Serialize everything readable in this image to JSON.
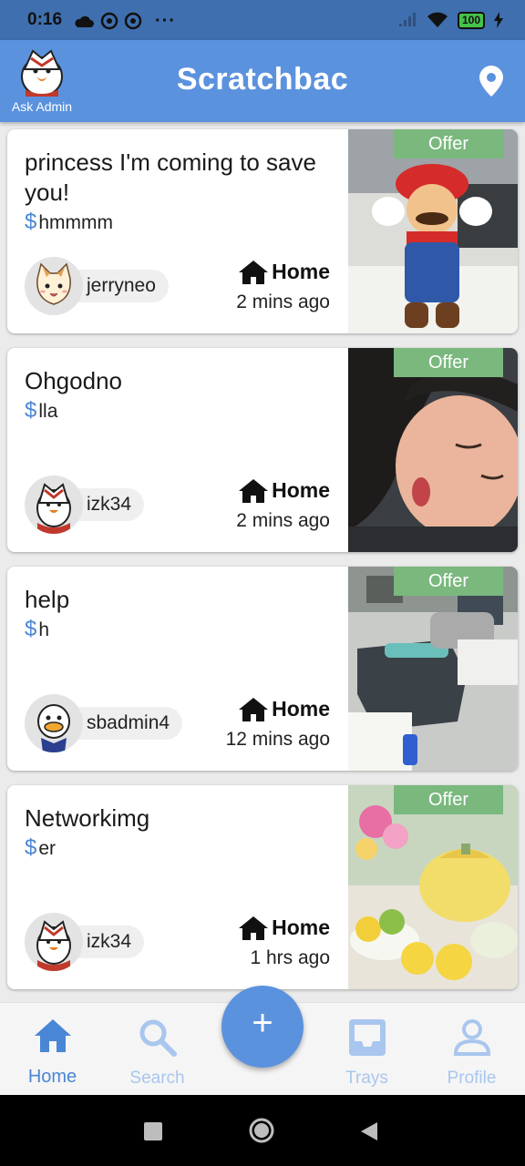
{
  "status_bar": {
    "time": "0:16",
    "battery": "100"
  },
  "header": {
    "title": "Scratchbac",
    "admin_label": "Ask Admin"
  },
  "listings": [
    {
      "title": "princess I'm coming to save you!",
      "price": "hmmmm",
      "user": "jerryneo",
      "location": "Home",
      "time_ago": "2 mins ago",
      "badge": "Offer"
    },
    {
      "title": "Ohgodno",
      "price": "lla",
      "user": "izk34",
      "location": "Home",
      "time_ago": "2 mins ago",
      "badge": "Offer"
    },
    {
      "title": "help",
      "price": "h",
      "user": "sbadmin4",
      "location": "Home",
      "time_ago": "12 mins ago",
      "badge": "Offer"
    },
    {
      "title": "Networkimg",
      "price": "er",
      "user": "izk34",
      "location": "Home",
      "time_ago": "1 hrs ago",
      "badge": "Offer"
    }
  ],
  "bottom_nav": {
    "home": "Home",
    "search": "Search",
    "add": "+",
    "trays": "Trays",
    "profile": "Profile"
  },
  "colors": {
    "brand": "#5b92de",
    "nav_active": "#4a86d6",
    "nav_inactive": "#a9c6ee",
    "offer_badge": "#7ab87e"
  }
}
